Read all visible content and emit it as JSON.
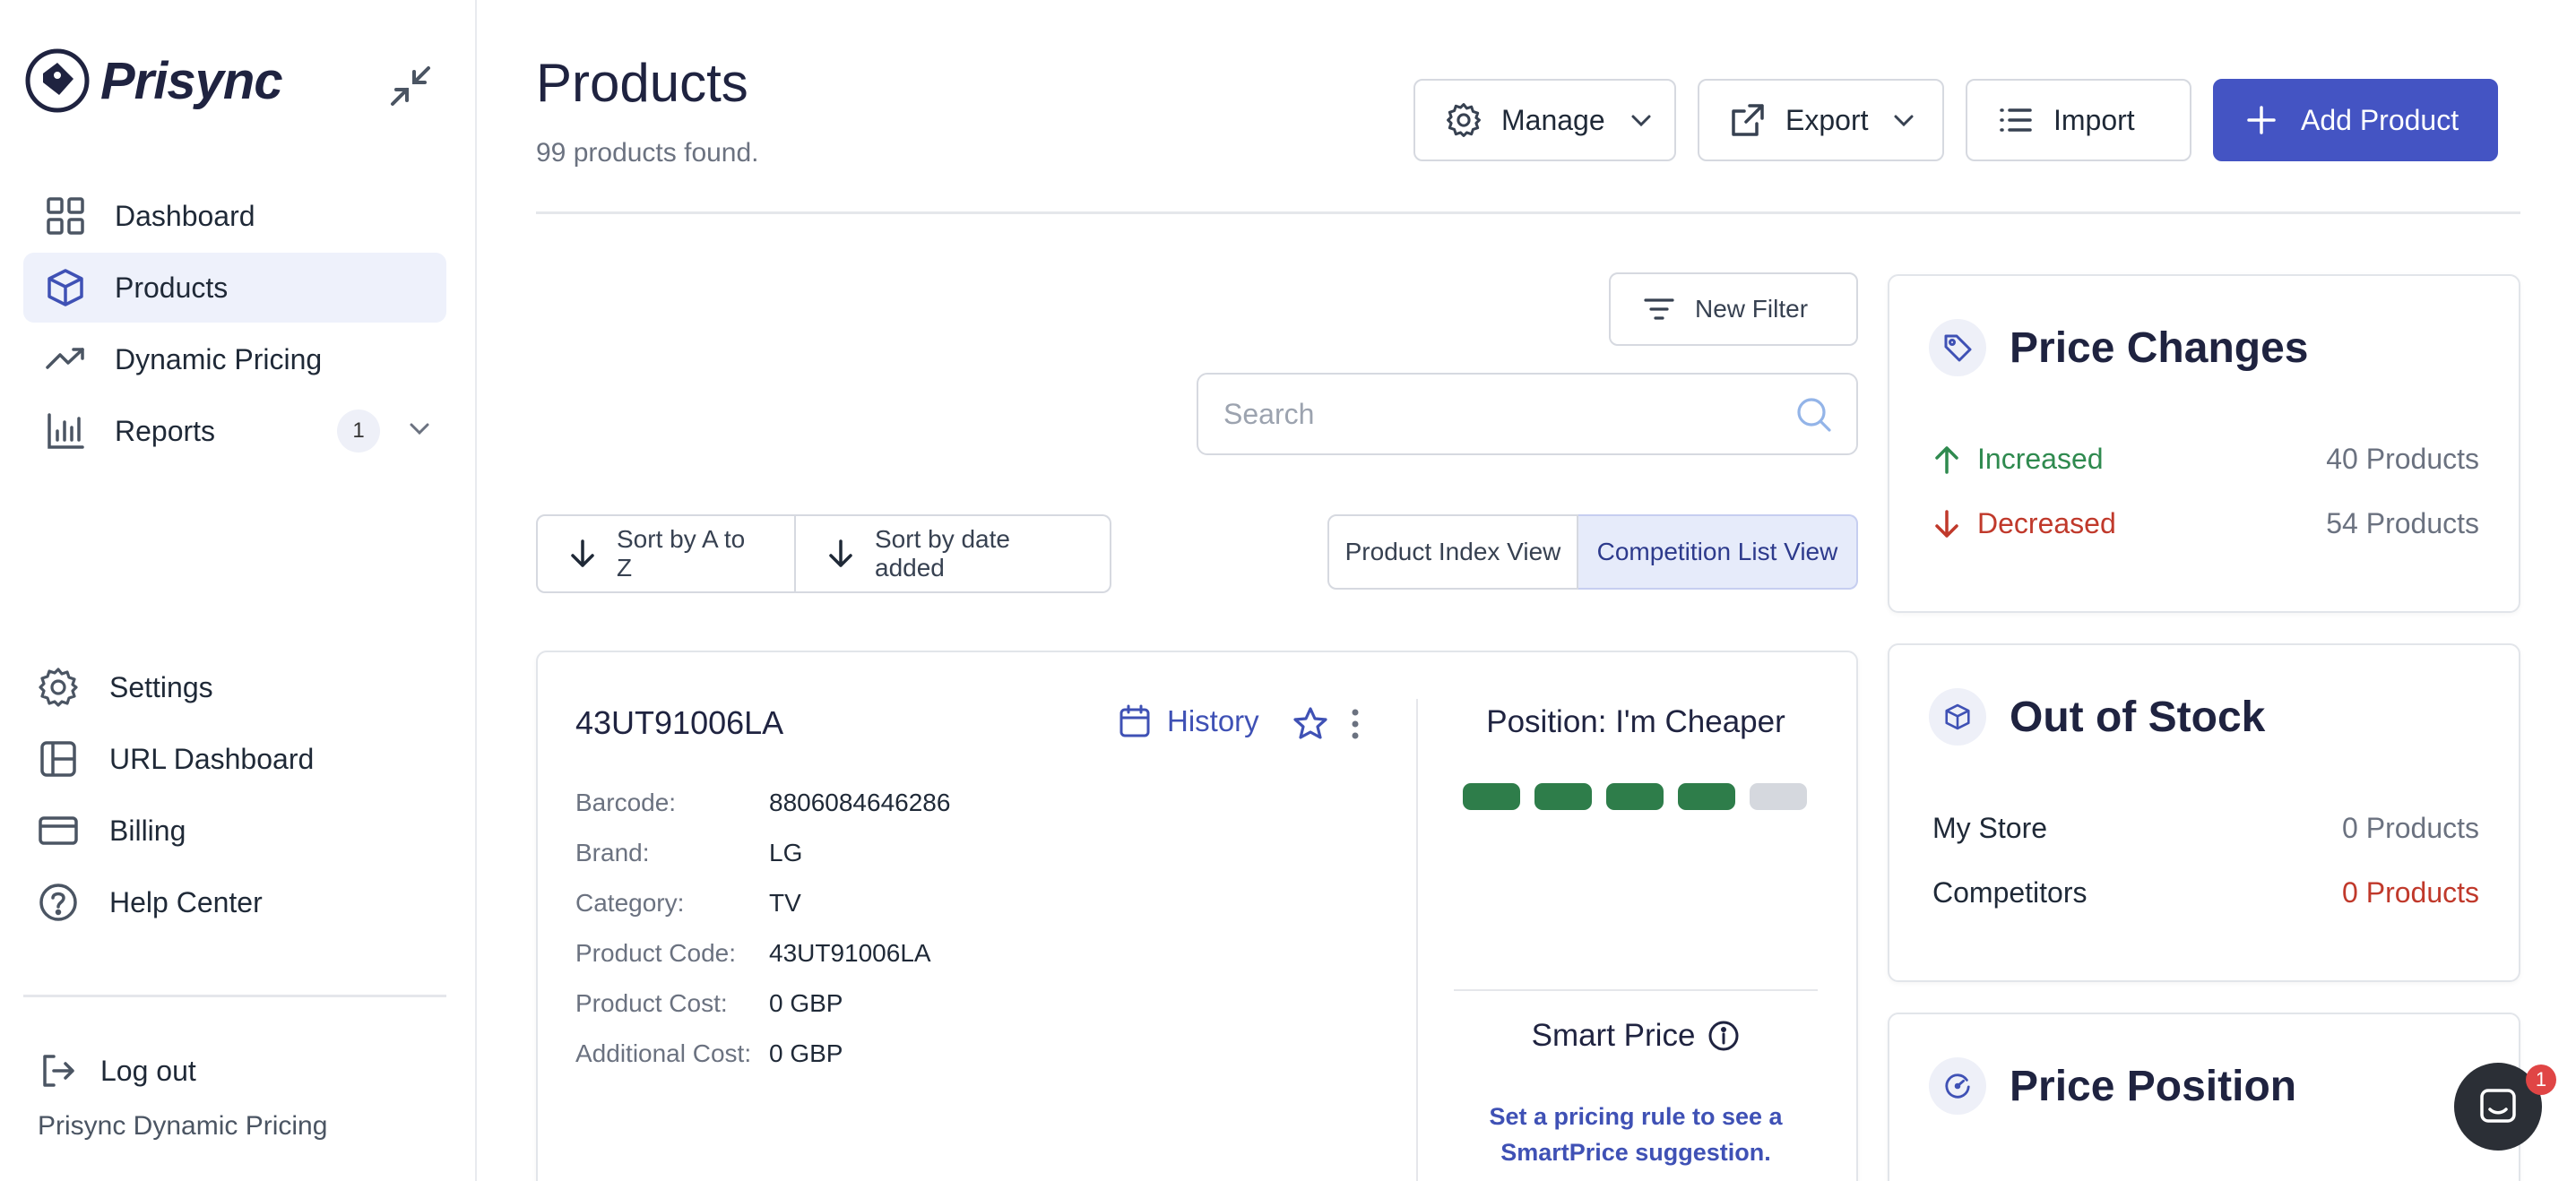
{
  "app": {
    "logo_text": "Prisync",
    "company_name": "Prisync Dynamic Pricing"
  },
  "sidebar": {
    "nav": [
      {
        "label": "Dashboard",
        "icon": "grid-icon"
      },
      {
        "label": "Products",
        "icon": "cube-icon",
        "active": true
      },
      {
        "label": "Dynamic Pricing",
        "icon": "trend-up-icon"
      },
      {
        "label": "Reports",
        "icon": "bar-chart-icon",
        "badge": "1"
      }
    ],
    "bottom": [
      {
        "label": "Settings",
        "icon": "gear-icon"
      },
      {
        "label": "URL Dashboard",
        "icon": "layout-icon"
      },
      {
        "label": "Billing",
        "icon": "credit-card-icon"
      },
      {
        "label": "Help Center",
        "icon": "help-circle-icon"
      }
    ],
    "logout": "Log out"
  },
  "header": {
    "title": "Products",
    "subtitle": "99 products found.",
    "manage": "Manage",
    "export": "Export",
    "import": "Import",
    "add_product": "Add Product"
  },
  "filters": {
    "new_filter": "New Filter",
    "search_placeholder": "Search",
    "sort_az": "Sort by A to Z",
    "sort_date": "Sort by date added",
    "view_index": "Product Index View",
    "view_competition": "Competition List View"
  },
  "product": {
    "code_title": "43UT91006LA",
    "history": "History",
    "details": [
      {
        "label": "Barcode:",
        "value": "8806084646286"
      },
      {
        "label": "Brand:",
        "value": "LG"
      },
      {
        "label": "Category:",
        "value": "TV"
      },
      {
        "label": "Product Code:",
        "value": "43UT91006LA"
      },
      {
        "label": "Product Cost:",
        "value": "0 GBP"
      },
      {
        "label": "Additional Cost:",
        "value": "0 GBP"
      }
    ],
    "position": "Position: I'm Cheaper",
    "position_level": 4,
    "position_total": 5,
    "colors": {
      "filled": "#2e7d4a",
      "empty": "#d5d8de"
    },
    "smart_price": "Smart Price",
    "smart_note": "Set a pricing rule to see a SmartPrice suggestion."
  },
  "price_changes": {
    "title": "Price Changes",
    "increased_label": "Increased",
    "increased_value": "40 Products",
    "decreased_label": "Decreased",
    "decreased_value": "54 Products"
  },
  "out_of_stock": {
    "title": "Out of Stock",
    "my_store_label": "My Store",
    "my_store_value": "0 Products",
    "competitors_label": "Competitors",
    "competitors_value": "0 Products"
  },
  "price_position": {
    "title": "Price Position"
  },
  "chat": {
    "badge": "1"
  }
}
